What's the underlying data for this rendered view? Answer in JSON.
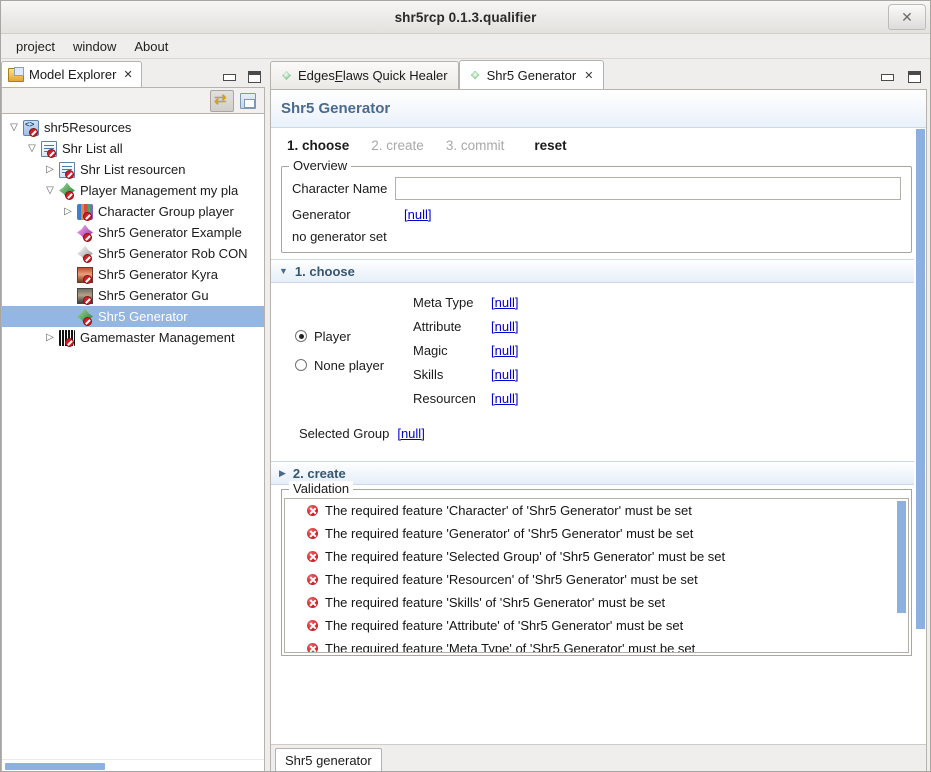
{
  "window": {
    "title": "shr5rcp 0.1.3.qualifier",
    "close_label": "✕"
  },
  "menubar": {
    "items": [
      {
        "label": "project"
      },
      {
        "label": "window"
      },
      {
        "label": "About"
      }
    ]
  },
  "left_view": {
    "tab_label": "Model Explorer",
    "tab_close": "✕",
    "toolbar": [
      {
        "name": "link-with-editor-icon",
        "pressed": true
      },
      {
        "name": "save-icon",
        "pressed": false
      }
    ],
    "minimize_label": "",
    "maximize_label": "",
    "tree": [
      {
        "label": "shr5Resources",
        "indent": 0,
        "twisty": "expanded",
        "icon": "resource",
        "selected": false
      },
      {
        "label": "Shr List all",
        "indent": 1,
        "twisty": "expanded",
        "icon": "list",
        "selected": false
      },
      {
        "label": "Shr List resourcen",
        "indent": 2,
        "twisty": "collapsed",
        "icon": "list",
        "selected": false
      },
      {
        "label": "Player Management my pla",
        "indent": 2,
        "twisty": "expanded",
        "icon": "player",
        "selected": false
      },
      {
        "label": "Character Group player ",
        "indent": 3,
        "twisty": "collapsed",
        "icon": "group",
        "selected": false
      },
      {
        "label": "Shr5 Generator Example",
        "indent": 3,
        "twisty": "none",
        "icon": "gen-purple",
        "selected": false
      },
      {
        "label": "Shr5 Generator Rob CON",
        "indent": 3,
        "twisty": "none",
        "icon": "gen-grey",
        "selected": false
      },
      {
        "label": "Shr5 Generator Kyra",
        "indent": 3,
        "twisty": "none",
        "icon": "photo-a",
        "selected": false
      },
      {
        "label": "Shr5 Generator Gu",
        "indent": 3,
        "twisty": "none",
        "icon": "photo-b",
        "selected": false
      },
      {
        "label": "Shr5 Generator",
        "indent": 3,
        "twisty": "none",
        "icon": "player",
        "selected": true
      },
      {
        "label": "Gamemaster Management",
        "indent": 2,
        "twisty": "collapsed",
        "icon": "gm",
        "selected": false
      }
    ]
  },
  "editor": {
    "tabs": [
      {
        "label": "EdgesFlaws Quick Healer",
        "mnemonic_split": [
          "Edges",
          "F",
          "laws Quick Healer"
        ],
        "active": false,
        "closable": false
      },
      {
        "label": "Shr5 Generator",
        "active": true,
        "closable": true,
        "close_label": "✕"
      }
    ],
    "form_title": "Shr5 Generator",
    "steps": [
      {
        "label": "1. choose",
        "state": "current"
      },
      {
        "label": "2. create",
        "state": "disabled"
      },
      {
        "label": "3. commit",
        "state": "disabled"
      },
      {
        "label": "reset",
        "state": "action"
      }
    ],
    "overview": {
      "legend": "Overview",
      "character_name_label": "Character Name",
      "character_name_value": "",
      "character_name_placeholder": "",
      "generator_label": "Generator",
      "generator_value": "[null]",
      "note": "no generator set"
    },
    "section_choose": {
      "title": "1. choose",
      "expanded": true,
      "twisty": "▼",
      "radios": [
        {
          "label": "Player",
          "checked": true
        },
        {
          "label": "None player",
          "checked": false
        }
      ],
      "fields": [
        {
          "label": "Meta Type",
          "value": "[null]"
        },
        {
          "label": "Attribute",
          "value": "[null]"
        },
        {
          "label": "Magic",
          "value": "[null]"
        },
        {
          "label": "Skills",
          "value": "[null]"
        },
        {
          "label": "Resourcen",
          "value": "[null]"
        }
      ],
      "selected_group_label": "Selected Group",
      "selected_group_value": "[null]"
    },
    "section_create": {
      "title": "2. create",
      "expanded": false,
      "twisty": "▶"
    },
    "validation": {
      "legend": "Validation",
      "messages": [
        "The required feature 'Character' of 'Shr5 Generator' must be set",
        "The required feature 'Generator' of 'Shr5 Generator' must be set",
        "The required feature 'Selected Group' of 'Shr5 Generator' must be set",
        "The required feature 'Resourcen' of 'Shr5 Generator' must be set",
        "The required feature 'Skills' of 'Shr5 Generator' must be set",
        "The required feature 'Attribute' of 'Shr5 Generator' must be set",
        "The required feature 'Meta Type' of 'Shr5 Generator' must be set"
      ]
    },
    "page_tabs": [
      {
        "label": "Shr5 generator",
        "active": true
      }
    ]
  },
  "colors": {
    "selection_blue": "#93b6e3",
    "scrollbar_blue": "#8cb0df",
    "hyperlink_blue": "#0000d0",
    "form_title_blue": "#4a6a8f",
    "error_red": "#d7262d"
  }
}
